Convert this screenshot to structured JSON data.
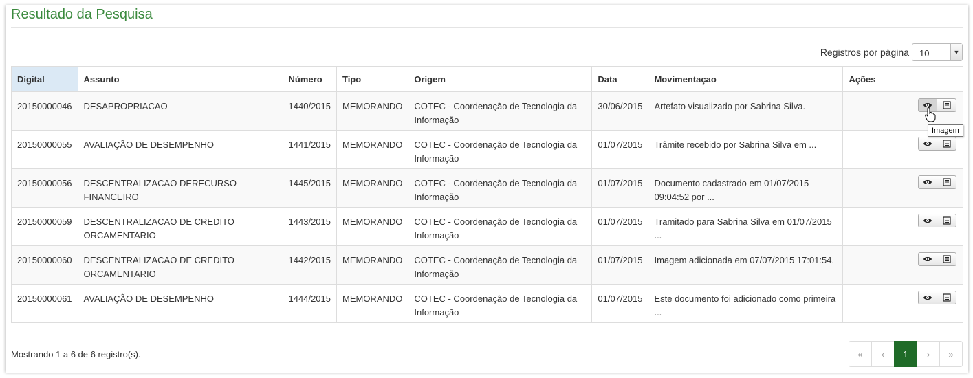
{
  "header": {
    "title": "Resultado da Pesquisa"
  },
  "page_size": {
    "label": "Registros por página",
    "value": "10"
  },
  "table": {
    "columns": [
      "Digital",
      "Assunto",
      "Número",
      "Tipo",
      "Origem",
      "Data",
      "Movimentaçao",
      "Ações"
    ],
    "rows": [
      {
        "digital": "20150000046",
        "assunto": "DESAPROPRIACAO",
        "numero": "1440/2015",
        "tipo": "MEMORANDO",
        "origem": "COTEC - Coordenação de Tecnologia da Informação",
        "data": "30/06/2015",
        "movimentacao": "Artefato visualizado por Sabrina Silva."
      },
      {
        "digital": "20150000055",
        "assunto": "AVALIAÇÃO DE DESEMPENHO",
        "numero": "1441/2015",
        "tipo": "MEMORANDO",
        "origem": "COTEC - Coordenação de Tecnologia da Informação",
        "data": "01/07/2015",
        "movimentacao": "Trâmite recebido por Sabrina Silva em ..."
      },
      {
        "digital": "20150000056",
        "assunto": "DESCENTRALIZACAO DERECURSO FINANCEIRO",
        "numero": "1445/2015",
        "tipo": "MEMORANDO",
        "origem": "COTEC - Coordenação de Tecnologia da Informação",
        "data": "01/07/2015",
        "movimentacao": "Documento cadastrado em 01/07/2015 09:04:52 por ..."
      },
      {
        "digital": "20150000059",
        "assunto": "DESCENTRALIZACAO DE CREDITO ORCAMENTARIO",
        "numero": "1443/2015",
        "tipo": "MEMORANDO",
        "origem": "COTEC - Coordenação de Tecnologia da Informação",
        "data": "01/07/2015",
        "movimentacao": "Tramitado para Sabrina Silva em 01/07/2015 ..."
      },
      {
        "digital": "20150000060",
        "assunto": "DESCENTRALIZACAO DE CREDITO ORCAMENTARIO",
        "numero": "1442/2015",
        "tipo": "MEMORANDO",
        "origem": "COTEC - Coordenação de Tecnologia da Informação",
        "data": "01/07/2015",
        "movimentacao": "Imagem adicionada em 07/07/2015 17:01:54."
      },
      {
        "digital": "20150000061",
        "assunto": "AVALIAÇÃO DE DESEMPENHO",
        "numero": "1444/2015",
        "tipo": "MEMORANDO",
        "origem": "COTEC - Coordenação de Tecnologia da Informação",
        "data": "01/07/2015",
        "movimentacao": "Este documento foi adicionado como primeira ..."
      }
    ],
    "actions": [
      {
        "icon": "eye-icon"
      },
      {
        "icon": "list-icon"
      }
    ]
  },
  "tooltip": {
    "text": "Imagem"
  },
  "footer": {
    "summary": "Mostrando 1 a 6 de 6 registro(s).",
    "pagination": [
      "«",
      "‹",
      "1",
      "›",
      "»"
    ],
    "current_page": "1"
  },
  "colors": {
    "title": "#3b8a3e",
    "active_page": "#1f6b28",
    "sorted_header": "#dbe9f5"
  }
}
